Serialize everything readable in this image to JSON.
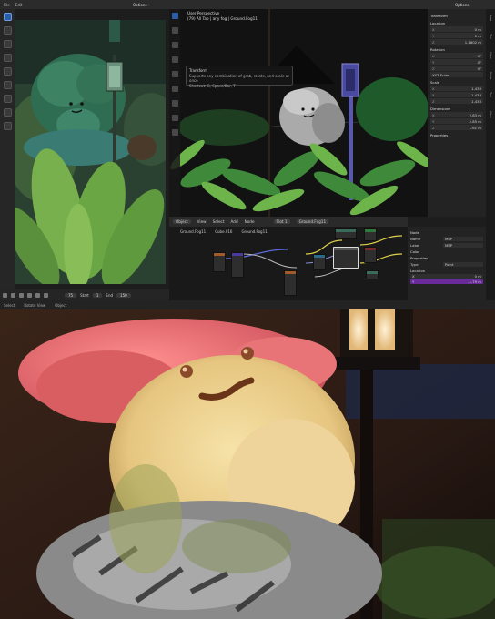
{
  "topbar": {
    "menus": [
      "File",
      "Edit"
    ],
    "options_label": "Options"
  },
  "viewport": {
    "title": "User Perspective",
    "subtitle": "(79) All Tab | any fog | Ground.Fog11"
  },
  "tooltip": {
    "title": "Transform",
    "description": "Supports any combination of grab, rotate, and scale at once",
    "shortcut": "Shortcut: G, Space/Bar, T"
  },
  "transform_panel": {
    "title": "Transform",
    "location_label": "Location",
    "location": [
      {
        "axis": "X",
        "value": "0 m"
      },
      {
        "axis": "Y",
        "value": "0 m"
      },
      {
        "axis": "Z",
        "value": "1.1602 m"
      }
    ],
    "rotation_label": "Rotation",
    "rotation": [
      {
        "axis": "X",
        "value": "0°"
      },
      {
        "axis": "Y",
        "value": "0°"
      },
      {
        "axis": "Z",
        "value": "0°"
      }
    ],
    "rotation_mode": "XYZ Euler",
    "scale_label": "Scale",
    "scale": [
      {
        "axis": "X",
        "value": "1.433"
      },
      {
        "axis": "Y",
        "value": "1.433"
      },
      {
        "axis": "Z",
        "value": "1.433"
      }
    ],
    "dimensions_label": "Dimensions",
    "dimensions": [
      {
        "axis": "X",
        "value": "2.83 m"
      },
      {
        "axis": "Y",
        "value": "2.85 m"
      },
      {
        "axis": "Z",
        "value": "1.61 m"
      }
    ],
    "properties_label": "Properties"
  },
  "side_tabs": [
    "Item",
    "Tool",
    "View",
    "Node",
    "Tool",
    "View"
  ],
  "node_header": {
    "object_mode": "Object",
    "menus": [
      "View",
      "Select",
      "Add",
      "Node"
    ],
    "slot": "Slot 1",
    "material": "Ground.Fog11"
  },
  "node_breadcrumbs": [
    "Ground.Fog11",
    "Cube.016",
    "Ground.Fog11"
  ],
  "node_panel": {
    "title": "Node",
    "name_label": "Name",
    "name_value": "MSP",
    "label_label": "Label",
    "label_value": "MSP",
    "color_label": "Color",
    "properties_label": "Properties",
    "type_label": "Type",
    "type_value": "Point",
    "location_label": "Location",
    "location": [
      {
        "axis": "X",
        "value": "0 m"
      },
      {
        "axis": "Y",
        "value": "-1.79 m"
      }
    ]
  },
  "timeline": {
    "current_frame": "75",
    "start_label": "Start",
    "start": "1",
    "end_label": "End",
    "end": "150"
  },
  "statusbar": {
    "items": [
      "Select",
      "Rotate View",
      "Object"
    ]
  }
}
